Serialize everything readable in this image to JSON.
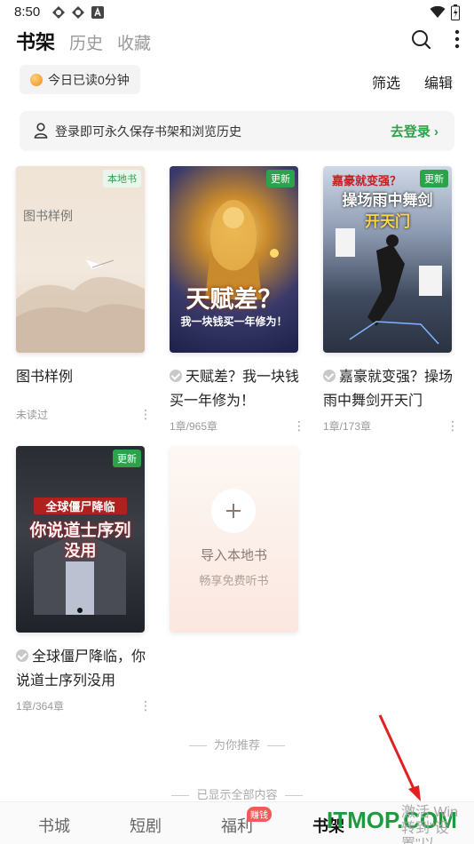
{
  "status_bar": {
    "time": "8:50"
  },
  "top_nav": {
    "tabs": [
      "书架",
      "历史",
      "收藏"
    ],
    "active_tab": "书架"
  },
  "reading": {
    "today_label": "今日已读0分钟"
  },
  "actions": {
    "filter": "筛选",
    "edit": "编辑"
  },
  "login_banner": {
    "message": "登录即可永久保存书架和浏览历史",
    "link": "去登录"
  },
  "books": [
    {
      "title": "图书样例",
      "badge": "本地书",
      "meta": "未读过",
      "cover_text": "图书样例",
      "read": false
    },
    {
      "title": "天赋差？我一块钱买一年修为！",
      "badge": "更新",
      "meta": "1章/965章",
      "cover_text": "天赋差？",
      "cover_sub": "我一块钱买一年修为！",
      "read": true
    },
    {
      "title": "嘉豪就变强？操场雨中舞剑开天门",
      "badge": "更新",
      "meta": "1章/173章",
      "cover_text": "操场雨中舞剑",
      "cover_top": "嘉豪就变强？",
      "cover_sub": "开天门",
      "read": true
    },
    {
      "title": "全球僵尸降临，你说道士序列没用",
      "badge": "更新",
      "meta": "1章/364章",
      "cover_top": "全球僵尸降临",
      "cover_text": "你说道士序列",
      "cover_sub": "没用",
      "read": true
    }
  ],
  "import_card": {
    "title": "导入本地书",
    "subtitle": "畅享免费听书"
  },
  "dividers": {
    "recommend": "为你推荐",
    "all_shown": "已显示全部内容"
  },
  "bottom_nav": {
    "items": [
      "书城",
      "短剧",
      "福利",
      "书架"
    ],
    "active": "书架",
    "earn_badge": "赚钱"
  },
  "overlay": {
    "watermark": "ITMOP.COM",
    "win_line1": "激活 Win",
    "win_line2": "转到\"设置\"以"
  },
  "colors": {
    "accent_green": "#2aa34a",
    "badge_red": "#f25a5a"
  }
}
